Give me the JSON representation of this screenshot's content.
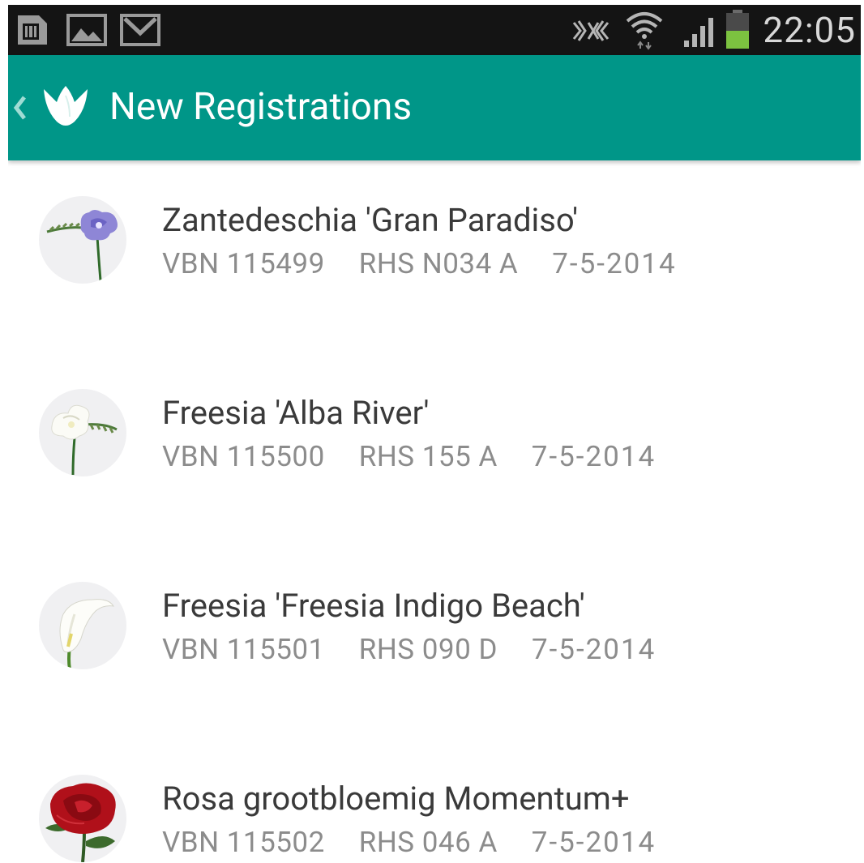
{
  "status_bar": {
    "time": "22:05",
    "battery_color": "#7cc240",
    "left_icons": [
      "sim-card-icon",
      "gallery-icon",
      "gmail-icon"
    ],
    "right_icons": [
      "nfc-icon",
      "wifi-icon",
      "signal-icon",
      "battery-icon"
    ]
  },
  "action_bar": {
    "title": "New Registrations",
    "color": "#009688",
    "icons": [
      "back-chevron-icon",
      "tulip-logo-icon"
    ]
  },
  "registrations": [
    {
      "name": "Zantedeschia 'Gran Paradiso'",
      "vbn": "VBN 115499",
      "rhs": "RHS N034 A",
      "date": "7-5-2014",
      "thumbnail": "purple-freesia-thumbnail"
    },
    {
      "name": "Freesia 'Alba River'",
      "vbn": "VBN 115500",
      "rhs": "RHS 155 A",
      "date": "7-5-2014",
      "thumbnail": "white-freesia-thumbnail"
    },
    {
      "name": "Freesia 'Freesia Indigo Beach'",
      "vbn": "VBN 115501",
      "rhs": "RHS 090 D",
      "date": "7-5-2014",
      "thumbnail": "white-calla-thumbnail"
    },
    {
      "name": "Rosa grootbloemig Momentum+",
      "vbn": "VBN 115502",
      "rhs": "RHS 046 A",
      "date": "7-5-2014",
      "thumbnail": "red-rose-thumbnail"
    }
  ]
}
